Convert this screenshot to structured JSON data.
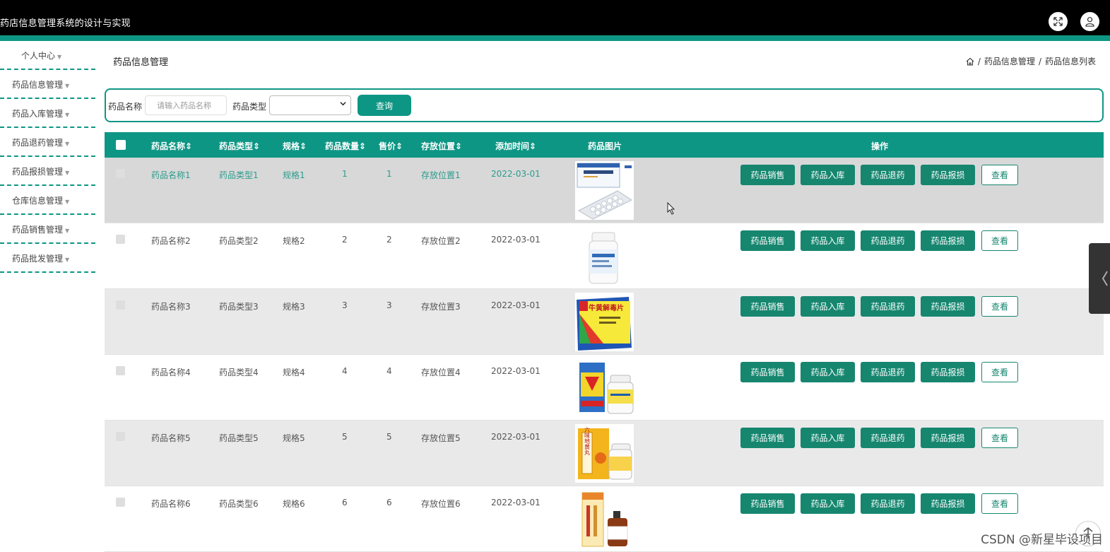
{
  "app": {
    "title": "药店信息管理系统的设计与实现"
  },
  "header": {
    "fullscreen_icon": "expand-icon",
    "user_icon": "user-icon"
  },
  "sidebar": {
    "items": [
      {
        "label": "个人中心"
      },
      {
        "label": "药品信息管理"
      },
      {
        "label": "药品入库管理"
      },
      {
        "label": "药品退药管理"
      },
      {
        "label": "药品报损管理"
      },
      {
        "label": "仓库信息管理"
      },
      {
        "label": "药品销售管理"
      },
      {
        "label": "药品批发管理"
      }
    ]
  },
  "page": {
    "title": "药品信息管理",
    "breadcrumb": [
      "药品信息管理",
      "药品信息列表"
    ]
  },
  "search": {
    "name_label": "药品名称",
    "name_placeholder": "请输入药品名称",
    "name_value": "",
    "type_label": "药品类型",
    "type_value": "",
    "query_button": "查询"
  },
  "table": {
    "headers": {
      "name": "药品名称",
      "type": "药品类型",
      "spec": "规格",
      "qty": "药品数量",
      "price": "售价",
      "location": "存放位置",
      "time": "添加时间",
      "image": "药品图片",
      "actions": "操作"
    },
    "action_labels": [
      "药品销售",
      "药品入库",
      "药品退药",
      "药品报损",
      "查看"
    ],
    "rows": [
      {
        "name": "药品名称1",
        "type": "药品类型1",
        "spec": "规格1",
        "qty": "1",
        "price": "1",
        "location": "存放位置1",
        "time": "2022-03-01"
      },
      {
        "name": "药品名称2",
        "type": "药品类型2",
        "spec": "规格2",
        "qty": "2",
        "price": "2",
        "location": "存放位置2",
        "time": "2022-03-01"
      },
      {
        "name": "药品名称3",
        "type": "药品类型3",
        "spec": "规格3",
        "qty": "3",
        "price": "3",
        "location": "存放位置3",
        "time": "2022-03-01"
      },
      {
        "name": "药品名称4",
        "type": "药品类型4",
        "spec": "规格4",
        "qty": "4",
        "price": "4",
        "location": "存放位置4",
        "time": "2022-03-01"
      },
      {
        "name": "药品名称5",
        "type": "药品类型5",
        "spec": "规格5",
        "qty": "5",
        "price": "5",
        "location": "存放位置5",
        "time": "2022-03-01"
      },
      {
        "name": "药品名称6",
        "type": "药品类型6",
        "spec": "规格6",
        "qty": "6",
        "price": "6",
        "location": "存放位置6",
        "time": "2022-03-01"
      }
    ]
  },
  "product_images": {
    "pkg3_label": "牛黄解毒片",
    "pkg5_label": "六味地黄丸"
  },
  "watermark": "CSDN @新星毕设项目",
  "colors": {
    "accent": "#0e9685",
    "button": "#16866f",
    "header_bg": "#000000"
  }
}
